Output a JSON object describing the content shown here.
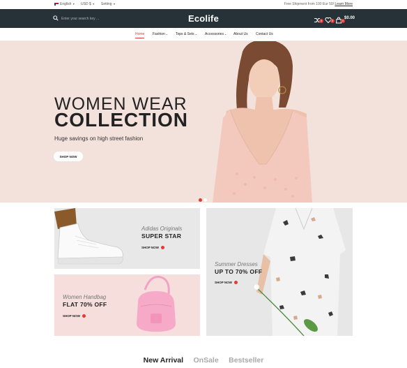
{
  "topbar": {
    "language": "English",
    "currency": "USD $",
    "setting": "Setting",
    "promo_text": "Free Shipment from 100 Eur 50/",
    "promo_link": "Learn More"
  },
  "header": {
    "logo": "Ecolife",
    "search_placeholder": "Enter your search key ...",
    "compare_count": "0",
    "wishlist_count": "0",
    "cart_count": "0",
    "cart_total": "$0.00"
  },
  "nav": {
    "items": [
      {
        "label": "Home",
        "dropdown": false
      },
      {
        "label": "Fashion",
        "dropdown": true
      },
      {
        "label": "Tops & Sets",
        "dropdown": true
      },
      {
        "label": "Accessories",
        "dropdown": true
      },
      {
        "label": "About Us",
        "dropdown": false
      },
      {
        "label": "Contact Us",
        "dropdown": false
      }
    ]
  },
  "hero": {
    "title_line1": "WOMEN WEAR",
    "title_line2": "COLLECTION",
    "subtitle": "Huge savings on high street fashion",
    "button": "SHOP NOW",
    "slide_count": 2,
    "active_slide": 1
  },
  "banners": {
    "adidas": {
      "subtitle": "Adidas Originals",
      "title": "SUPER STAR",
      "link": "SHOP NOW"
    },
    "handbag": {
      "subtitle": "Women Handbag",
      "title": "FLAT 70% OFF",
      "link": "SHOP NOW"
    },
    "summer": {
      "subtitle": "Summer Dresses",
      "title": "UP TO 70% OFF",
      "link": "SHOP NOW"
    }
  },
  "tabs": [
    {
      "label": "New Arrival",
      "active": true
    },
    {
      "label": "OnSale",
      "active": false
    },
    {
      "label": "Bestseller",
      "active": false
    }
  ],
  "colors": {
    "header_bg": "#263238",
    "accent": "#e53935",
    "hero_bg": "#f3e1dc"
  }
}
